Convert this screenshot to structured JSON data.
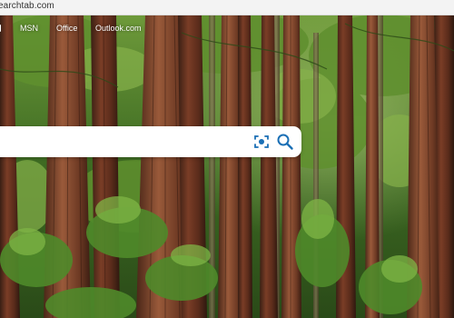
{
  "browser": {
    "url": "earchtab.com"
  },
  "topnav": {
    "links": [
      {
        "label": "MSN"
      },
      {
        "label": "Office"
      },
      {
        "label": "Outlook.com"
      }
    ]
  },
  "search": {
    "value": "",
    "placeholder": "",
    "visual_search_icon": "camera-scan-icon",
    "search_icon": "magnifier-icon",
    "accent_color": "#1a6fb5"
  },
  "background": {
    "description_icon": "redwood-forest-photo"
  }
}
